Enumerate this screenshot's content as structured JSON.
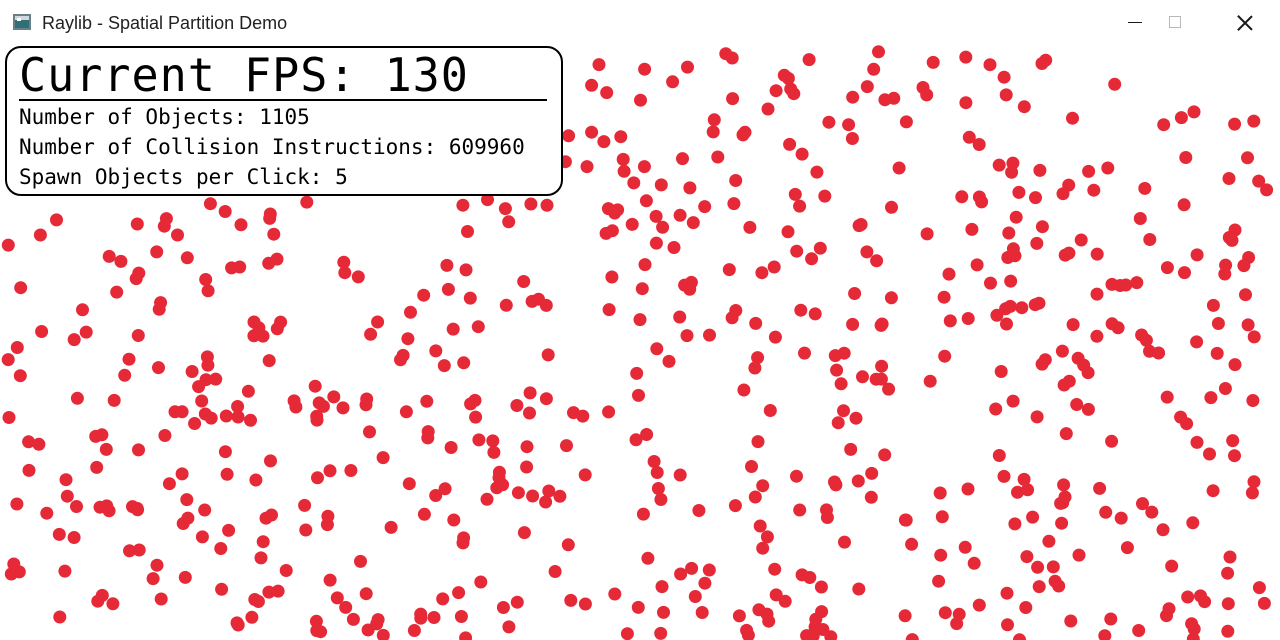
{
  "window": {
    "title": "Raylib - Spatial Partition Demo",
    "icon": "raylib-app-icon",
    "controls": {
      "minimize_icon": "minimize-icon",
      "maximize_icon": "maximize-icon",
      "close_icon": "close-icon"
    }
  },
  "hud": {
    "fps_label": "Current FPS: 130",
    "objects_label": "Number of Objects: 1105",
    "instructions_label": "Number of Collision Instructions: 609960",
    "spawn_label": "Spawn Objects per Click: 5"
  },
  "scene": {
    "background_color": "#ffffff",
    "object_color": "#e62937",
    "object_shape": "circle"
  }
}
